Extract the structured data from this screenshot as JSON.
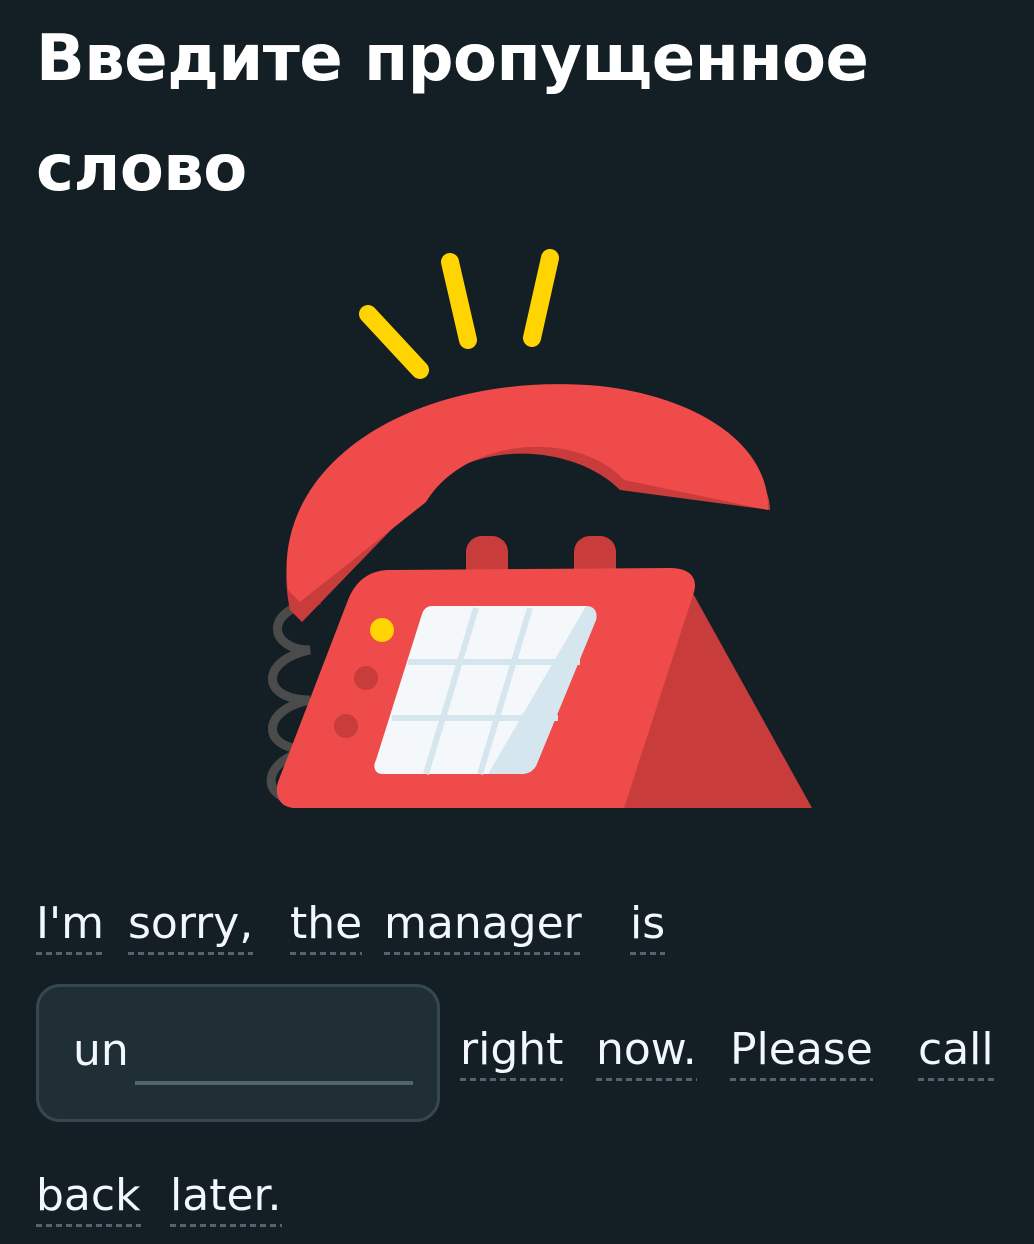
{
  "header": {
    "title": "Введите пропущенное слово"
  },
  "illustration": {
    "icon": "ringing-red-telephone",
    "colors": {
      "phone_red": "#ef4b4b",
      "phone_shadow": "#c93c3c",
      "ring_lines": "#ffd400",
      "keypad": "#f4f8fb",
      "cord": "#4b4b4b"
    }
  },
  "exercise": {
    "line1_words": [
      "I'm",
      "sorry,",
      "the",
      "manager",
      "is"
    ],
    "blank": {
      "prefix": "un",
      "value": "",
      "placeholder": ""
    },
    "line2_words": [
      "right",
      "now.",
      "Please",
      "call"
    ],
    "line3_words": [
      "back",
      "later."
    ]
  },
  "colors": {
    "background": "#131f24",
    "text": "#f1f7fb",
    "input_bg": "#202f36",
    "input_border": "#37464f",
    "underline": "#52656d"
  }
}
